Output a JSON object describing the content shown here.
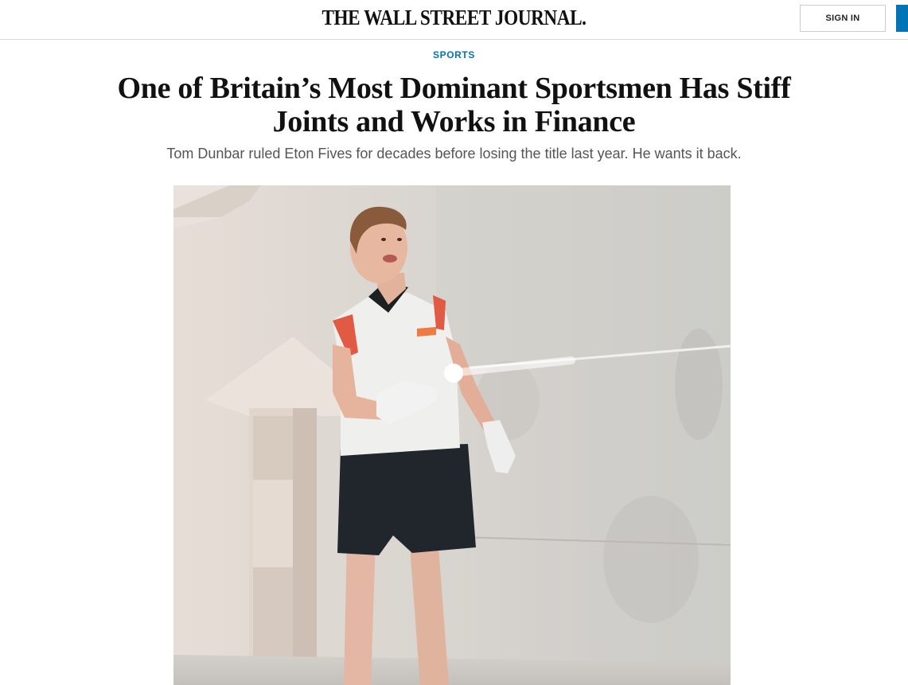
{
  "header": {
    "masthead": "THE WALL STREET JOURNAL.",
    "signin_label": "SIGN IN"
  },
  "article": {
    "section": "SPORTS",
    "headline": "One of Britain’s Most Dominant Sportsmen Has Stiff Joints and Works in Finance",
    "dek": "Tom Dunbar ruled Eton Fives for decades before losing the title last year. He wants it back."
  },
  "colors": {
    "accent": "#0274b6",
    "text": "#111111",
    "dek": "#555555"
  }
}
